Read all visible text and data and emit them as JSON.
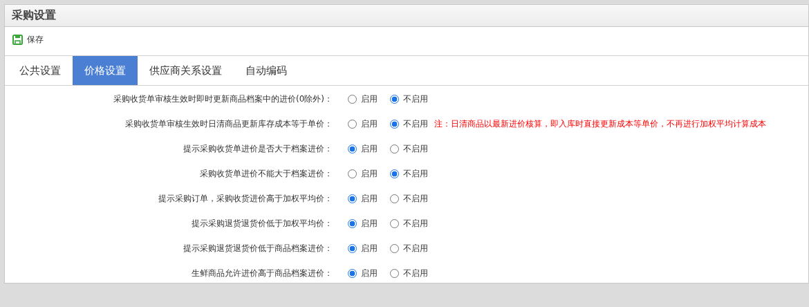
{
  "window": {
    "title": "采购设置"
  },
  "toolbar": {
    "save_label": "保存"
  },
  "tabs": [
    {
      "label": "公共设置",
      "selected": false
    },
    {
      "label": "价格设置",
      "selected": true
    },
    {
      "label": "供应商关系设置",
      "selected": false
    },
    {
      "label": "自动编码",
      "selected": false
    }
  ],
  "settings": [
    {
      "label": "采购收货单审核生效时即时更新商品档案中的进价(0除外)：",
      "options": [
        {
          "label": "启用",
          "selected": false
        },
        {
          "label": "不启用",
          "selected": true
        }
      ]
    },
    {
      "label": "采购收货单审核生效时日清商品更新库存成本等于单价：",
      "options": [
        {
          "label": "启用",
          "selected": false
        },
        {
          "label": "不启用",
          "selected": true
        }
      ],
      "note": "注：日清商品以最新进价核算，即入库时直接更新成本等单价，不再进行加权平均计算成本"
    },
    {
      "label": "提示采购收货单进价是否大于档案进价：",
      "options": [
        {
          "label": "启用",
          "selected": true
        },
        {
          "label": "不启用",
          "selected": false
        }
      ]
    },
    {
      "label": "采购收货单进价不能大于档案进价：",
      "options": [
        {
          "label": "启用",
          "selected": false
        },
        {
          "label": "不启用",
          "selected": true
        }
      ]
    },
    {
      "label": "提示采购订单，采购收货进价高于加权平均价：",
      "options": [
        {
          "label": "启用",
          "selected": true
        },
        {
          "label": "不启用",
          "selected": false
        }
      ]
    },
    {
      "label": "提示采购退货退货价低于加权平均价：",
      "options": [
        {
          "label": "启用",
          "selected": true
        },
        {
          "label": "不启用",
          "selected": false
        }
      ]
    },
    {
      "label": "提示采购退货退货价低于商品档案进价：",
      "options": [
        {
          "label": "启用",
          "selected": true
        },
        {
          "label": "不启用",
          "selected": false
        }
      ]
    },
    {
      "label": "生鲜商品允许进价高于商品档案进价：",
      "options": [
        {
          "label": "启用",
          "selected": true
        },
        {
          "label": "不启用",
          "selected": false
        }
      ]
    }
  ]
}
